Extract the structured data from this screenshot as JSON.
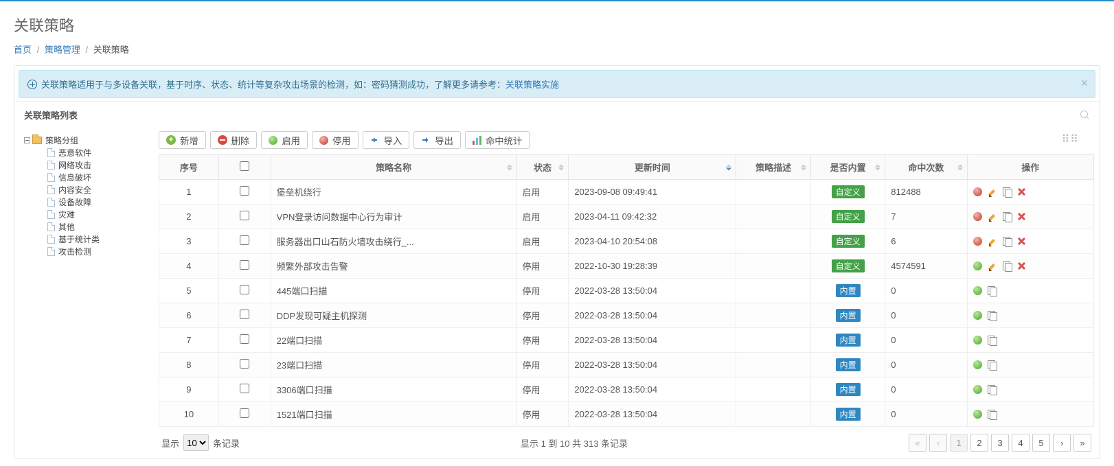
{
  "page_title": "关联策略",
  "breadcrumb": {
    "home": "首页",
    "group": "策略管理",
    "active": "关联策略"
  },
  "alert": {
    "text": "关联策略适用于与多设备关联，基于时序、状态、统计等复杂攻击场景的检测，如：密码猜测成功，了解更多请参考：",
    "link": "关联策略实施"
  },
  "list_title": "关联策略列表",
  "tree": {
    "root": "策略分组",
    "items": [
      "恶意软件",
      "网络攻击",
      "信息破坏",
      "内容安全",
      "设备故障",
      "灾难",
      "其他",
      "基于统计类",
      "攻击检测"
    ]
  },
  "toolbar": {
    "add": "新增",
    "delete": "删除",
    "enable": "启用",
    "disable": "停用",
    "import": "导入",
    "export": "导出",
    "stats": "命中统计"
  },
  "columns": {
    "idx": "序号",
    "name": "策略名称",
    "state": "状态",
    "time": "更新时间",
    "desc": "策略描述",
    "builtin": "是否内置",
    "hits": "命中次数",
    "ops": "操作"
  },
  "state_labels": {
    "enabled": "启用",
    "disabled": "停用"
  },
  "builtin_labels": {
    "custom": "自定义",
    "builtin": "内置"
  },
  "rows": [
    {
      "idx": "1",
      "name": "堡垒机绕行",
      "state": "enabled",
      "time": "2023-09-08 09:49:41",
      "desc": "",
      "builtin": "custom",
      "hits": "812488",
      "ops": "full_red"
    },
    {
      "idx": "2",
      "name": "VPN登录访问数据中心行为审计",
      "state": "enabled",
      "time": "2023-04-11 09:42:32",
      "desc": "",
      "builtin": "custom",
      "hits": "7",
      "ops": "full_red"
    },
    {
      "idx": "3",
      "name": "服务器出口山石防火墙攻击绕行_...",
      "state": "enabled",
      "time": "2023-04-10 20:54:08",
      "desc": "",
      "builtin": "custom",
      "hits": "6",
      "ops": "full_red"
    },
    {
      "idx": "4",
      "name": "频繁外部攻击告警",
      "state": "disabled",
      "time": "2022-10-30 19:28:39",
      "desc": "",
      "builtin": "custom",
      "hits": "4574591",
      "ops": "full_green"
    },
    {
      "idx": "5",
      "name": "445端口扫描",
      "state": "disabled",
      "time": "2022-03-28 13:50:04",
      "desc": "",
      "builtin": "builtin",
      "hits": "0",
      "ops": "min"
    },
    {
      "idx": "6",
      "name": "DDP发现可疑主机探测",
      "state": "disabled",
      "time": "2022-03-28 13:50:04",
      "desc": "",
      "builtin": "builtin",
      "hits": "0",
      "ops": "min"
    },
    {
      "idx": "7",
      "name": "22端口扫描",
      "state": "disabled",
      "time": "2022-03-28 13:50:04",
      "desc": "",
      "builtin": "builtin",
      "hits": "0",
      "ops": "min"
    },
    {
      "idx": "8",
      "name": "23端口扫描",
      "state": "disabled",
      "time": "2022-03-28 13:50:04",
      "desc": "",
      "builtin": "builtin",
      "hits": "0",
      "ops": "min"
    },
    {
      "idx": "9",
      "name": "3306端口扫描",
      "state": "disabled",
      "time": "2022-03-28 13:50:04",
      "desc": "",
      "builtin": "builtin",
      "hits": "0",
      "ops": "min"
    },
    {
      "idx": "10",
      "name": "1521端口扫描",
      "state": "disabled",
      "time": "2022-03-28 13:50:04",
      "desc": "",
      "builtin": "builtin",
      "hits": "0",
      "ops": "min"
    }
  ],
  "footer": {
    "show": "显示",
    "per": "10",
    "records": "条记录",
    "info": "显示 1 到 10 共 313 条记录",
    "pages": [
      "1",
      "2",
      "3",
      "4",
      "5"
    ]
  }
}
